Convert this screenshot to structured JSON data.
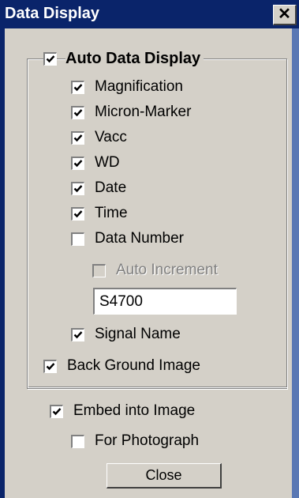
{
  "window": {
    "title": "Data Display",
    "close_glyph": "✕",
    "close_icon": "close-icon"
  },
  "group": {
    "auto_data_display": {
      "label": "Auto Data Display",
      "checked": true
    },
    "items": [
      {
        "label": "Magnification",
        "checked": true,
        "enabled": true
      },
      {
        "label": "Micron-Marker",
        "checked": true,
        "enabled": true
      },
      {
        "label": "Vacc",
        "checked": true,
        "enabled": true
      },
      {
        "label": "WD",
        "checked": true,
        "enabled": true
      },
      {
        "label": "Date",
        "checked": true,
        "enabled": true
      },
      {
        "label": "Time",
        "checked": true,
        "enabled": true
      },
      {
        "label": "Data Number",
        "checked": false,
        "enabled": true
      }
    ],
    "auto_increment": {
      "label": "Auto Increment",
      "checked": false,
      "enabled": false
    },
    "data_number_value": "S4700",
    "signal_name": {
      "label": "Signal Name",
      "checked": true
    },
    "back_ground_image": {
      "label": "Back Ground Image",
      "checked": true
    }
  },
  "embed_into_image": {
    "label": "Embed into Image",
    "checked": true
  },
  "for_photograph": {
    "label": "For Photograph",
    "checked": false
  },
  "close_button": {
    "label": "Close"
  },
  "colors": {
    "titlebar": "#0a246a",
    "face": "#d4d0c8"
  }
}
